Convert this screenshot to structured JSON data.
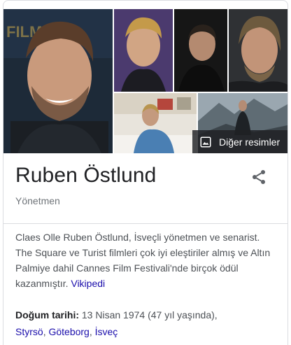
{
  "person": {
    "name": "Ruben Östlund",
    "subtitle": "Yönetmen"
  },
  "gallery": {
    "more_images_label": "Diğer resimler",
    "banner_text": "FILM"
  },
  "description": {
    "text": "Claes Olle Ruben Östlund, İsveçli yönetmen ve senarist. The Square ve Turist filmleri çok iyi eleştiriler almış ve Altın Palmiye dahil Cannes Film Festivali'nde birçok ödül kazanmıştır.",
    "source_link": "Vikipedi"
  },
  "birth": {
    "label": "Doğum tarihi:",
    "value": "13 Nisan 1974 (47 yıl yaşında),",
    "place_links": [
      "Styrsö",
      "Göteborg",
      "İsveç"
    ]
  },
  "icons": {
    "share": "share-icon",
    "image": "image-icon"
  },
  "colors": {
    "link": "#1a0dab",
    "text": "#202124",
    "muted": "#70757a"
  }
}
